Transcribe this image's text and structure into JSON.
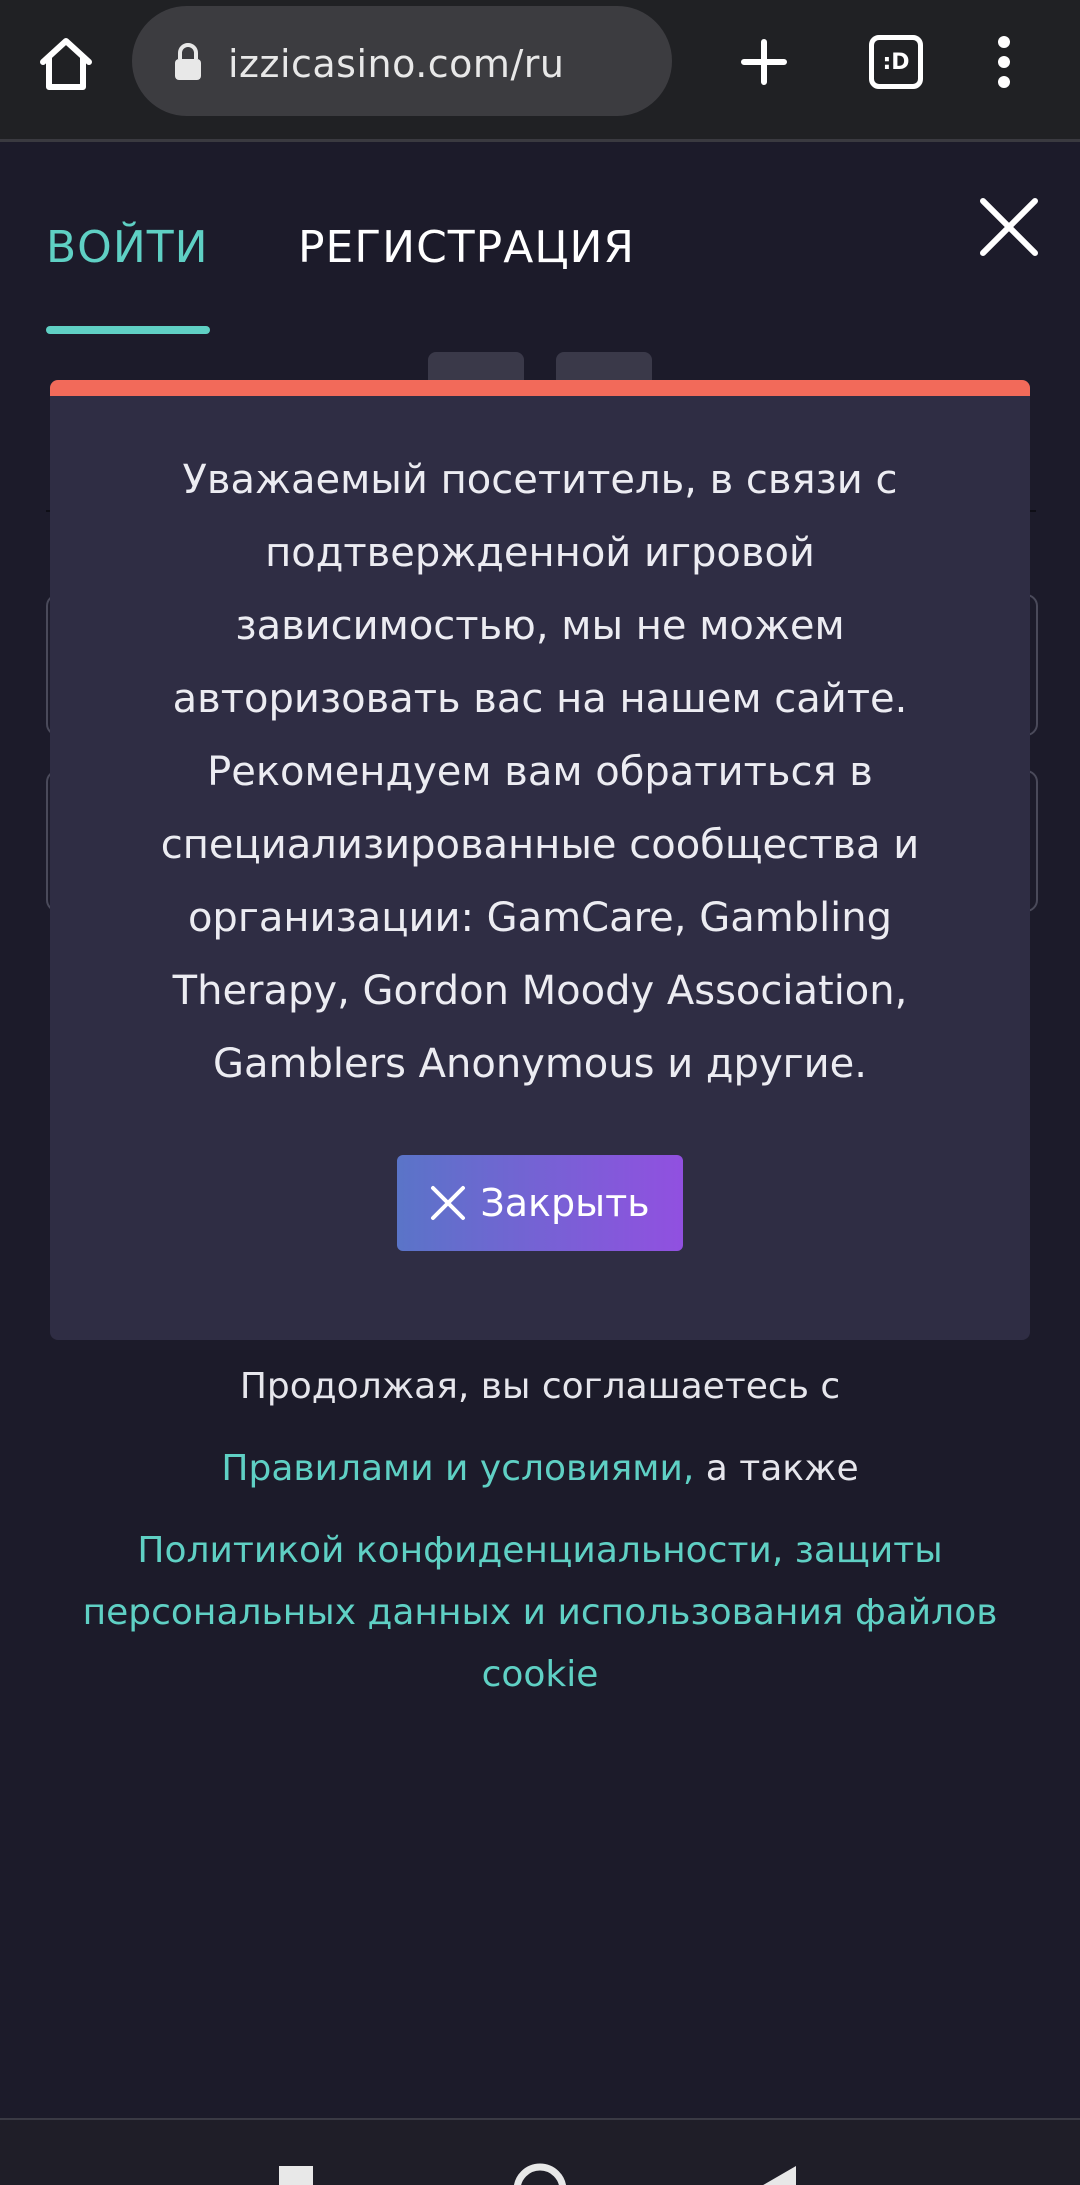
{
  "browser": {
    "url": "izzicasino.com/ru",
    "tab_count_label": ":D"
  },
  "auth": {
    "tab_login": "ВОЙТИ",
    "tab_register": "РЕГИСТРАЦИЯ",
    "active_tab_color": "#5fd0c4"
  },
  "modal": {
    "lines": [
      "Уважаемый посетитель, в связи с",
      "подтвержденной игровой",
      "зависимостью, мы не можем",
      "авторизовать вас на нашем сайте.",
      "Рекомендуем вам обратиться в",
      "специализированные сообщества и",
      "организации: GamCare, Gambling",
      "Therapy, Gordon Moody Association,",
      "Gamblers Anonymous и другие."
    ],
    "close_label": "Закрыть",
    "accent_color": "#f26a5a"
  },
  "terms": {
    "continue_text": "Продолжая, вы соглашаетесь с",
    "rules_link": "Правилами и условиями,",
    "also_text": " а также",
    "privacy_link_line1": "Политикой конфиденциальности, защиты",
    "privacy_link_line2": "персональных данных и использования файлов",
    "privacy_link_line3": "cookie"
  },
  "icons": [
    "home-icon",
    "lock-icon",
    "plus-icon",
    "tabs-icon",
    "more-vert-icon",
    "close-icon",
    "back-icon",
    "recents-icon"
  ]
}
